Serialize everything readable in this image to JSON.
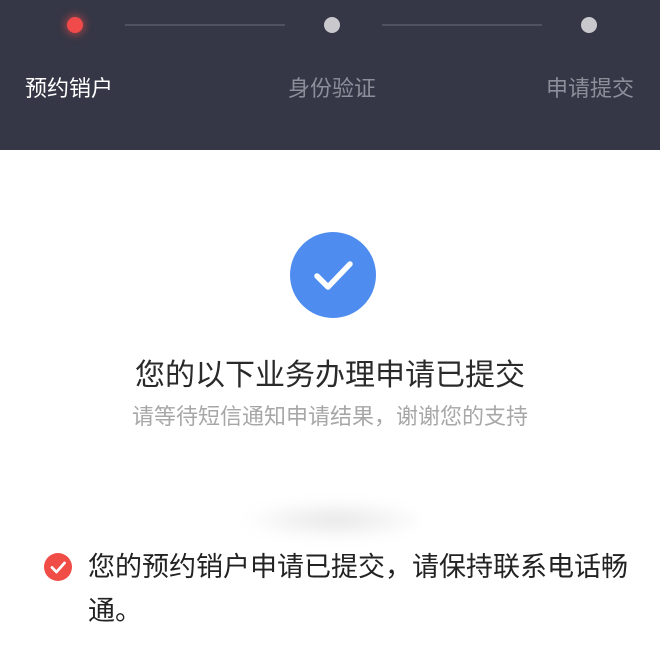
{
  "stepper": {
    "steps": [
      {
        "label": "预约销户",
        "state": "active"
      },
      {
        "label": "身份验证",
        "state": "pending"
      },
      {
        "label": "申请提交",
        "state": "pending"
      }
    ]
  },
  "result": {
    "icon": "check-circle-icon",
    "title": "您的以下业务办理申请已提交",
    "subtitle": "请等待短信通知申请结果，谢谢您的支持"
  },
  "notice": {
    "icon": "check-circle-red-icon",
    "text": "您的预约销户申请已提交，请保持联系电话畅通。"
  },
  "colors": {
    "header_bg": "#353746",
    "active_dot": "#f04a4a",
    "check_blue": "#4e8cf0",
    "notice_red": "#ef4d46"
  }
}
